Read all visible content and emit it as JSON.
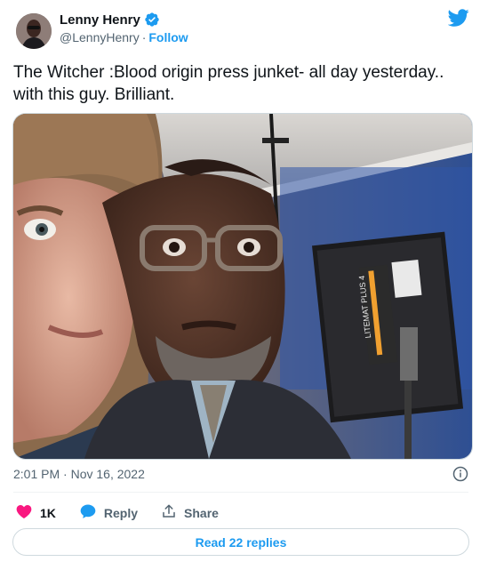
{
  "author": {
    "name": "Lenny Henry",
    "handle": "@LennyHenry",
    "separator": "·",
    "follow_label": "Follow"
  },
  "tweet": {
    "text": "The Witcher :Blood origin press junket- all day yesterday..\nwith this guy. Brilliant.",
    "timestamp": "2:01 PM · Nov 16, 2022"
  },
  "media": {
    "light_panel_label": "LITEMAT PLUS 4"
  },
  "actions": {
    "like_count": "1K",
    "reply_label": "Reply",
    "share_label": "Share",
    "read_replies_label": "Read 22 replies"
  },
  "colors": {
    "brand_blue": "#1d9bf0",
    "like_pink": "#f91880",
    "secondary_text": "#536471"
  },
  "icons": [
    "verified-badge-icon",
    "twitter-bird-icon",
    "info-icon",
    "heart-icon",
    "reply-bubble-icon",
    "share-icon"
  ]
}
